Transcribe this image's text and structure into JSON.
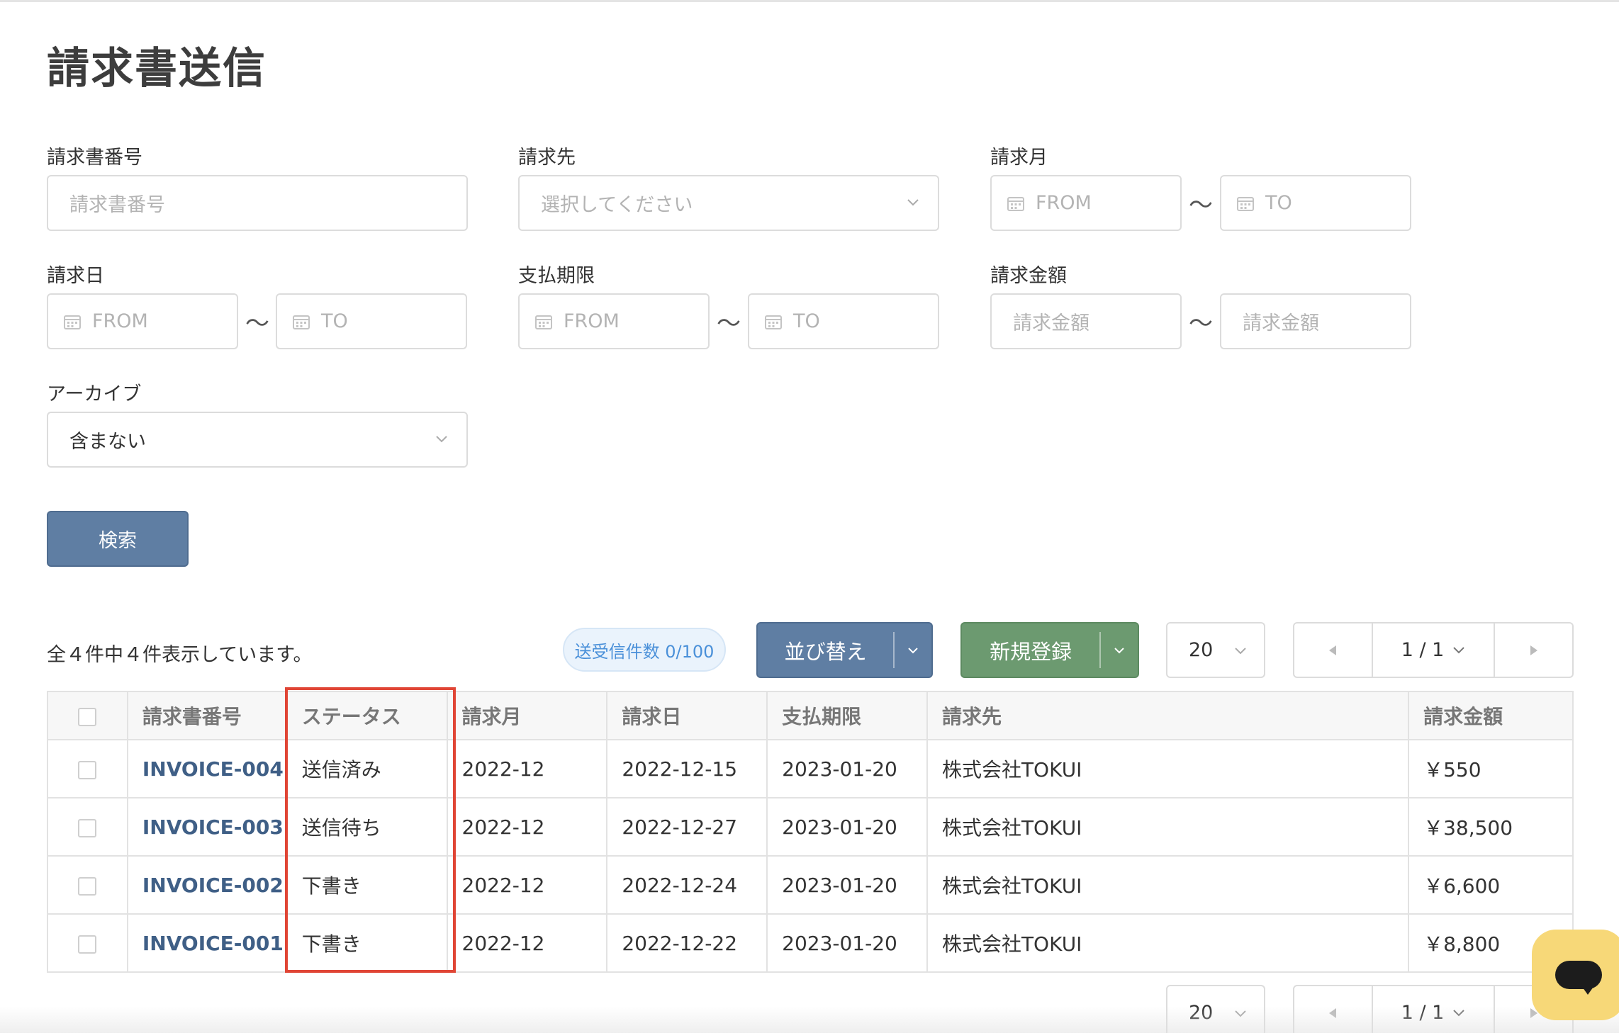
{
  "page": {
    "title": "請求書送信"
  },
  "filters": {
    "invoice_number": {
      "label": "請求書番号",
      "placeholder": "請求書番号"
    },
    "recipient": {
      "label": "請求先",
      "placeholder": "選択してください"
    },
    "billing_month": {
      "label": "請求月",
      "from": "FROM",
      "to": "TO"
    },
    "billing_date": {
      "label": "請求日",
      "from": "FROM",
      "to": "TO"
    },
    "due_date": {
      "label": "支払期限",
      "from": "FROM",
      "to": "TO"
    },
    "amount": {
      "label": "請求金額",
      "from_placeholder": "請求金額",
      "to_placeholder": "請求金額"
    },
    "archive": {
      "label": "アーカイブ",
      "value": "含まない"
    },
    "range_separator": "～",
    "search_label": "検索"
  },
  "toolbar": {
    "summary": "全４件中４件表示しています。",
    "send_count_badge": "送受信件数 0/100",
    "sort_label": "並び替え",
    "new_label": "新規登録",
    "per_page": "20",
    "page_indicator": "1 / 1"
  },
  "table": {
    "headers": [
      "請求書番号",
      "ステータス",
      "請求月",
      "請求日",
      "支払期限",
      "請求先",
      "請求金額"
    ],
    "rows": [
      {
        "invoice": "INVOICE-004",
        "status": "送信済み",
        "month": "2022-12",
        "date": "2022-12-15",
        "due": "2023-01-20",
        "recipient": "株式会社TOKUI",
        "amount": "￥550"
      },
      {
        "invoice": "INVOICE-003",
        "status": "送信待ち",
        "month": "2022-12",
        "date": "2022-12-27",
        "due": "2023-01-20",
        "recipient": "株式会社TOKUI",
        "amount": "￥38,500"
      },
      {
        "invoice": "INVOICE-002",
        "status": "下書き",
        "month": "2022-12",
        "date": "2022-12-24",
        "due": "2023-01-20",
        "recipient": "株式会社TOKUI",
        "amount": "￥6,600"
      },
      {
        "invoice": "INVOICE-001",
        "status": "下書き",
        "month": "2022-12",
        "date": "2022-12-22",
        "due": "2023-01-20",
        "recipient": "株式会社TOKUI",
        "amount": "￥8,800"
      }
    ]
  },
  "bottom": {
    "per_page": "20",
    "page_indicator": "1 / 1"
  },
  "icons": {
    "calendar": "calendar-icon",
    "chevron": "chevron-down-icon",
    "prev": "caret-left-icon",
    "next": "caret-right-icon",
    "chat": "chat-bubble-icon"
  },
  "colors": {
    "primary": "#5f7ea3",
    "success": "#6c9a70",
    "link": "#3f5f86",
    "badge_text": "#4a90d9",
    "highlight": "#e04535",
    "chat": "#f7d878"
  }
}
